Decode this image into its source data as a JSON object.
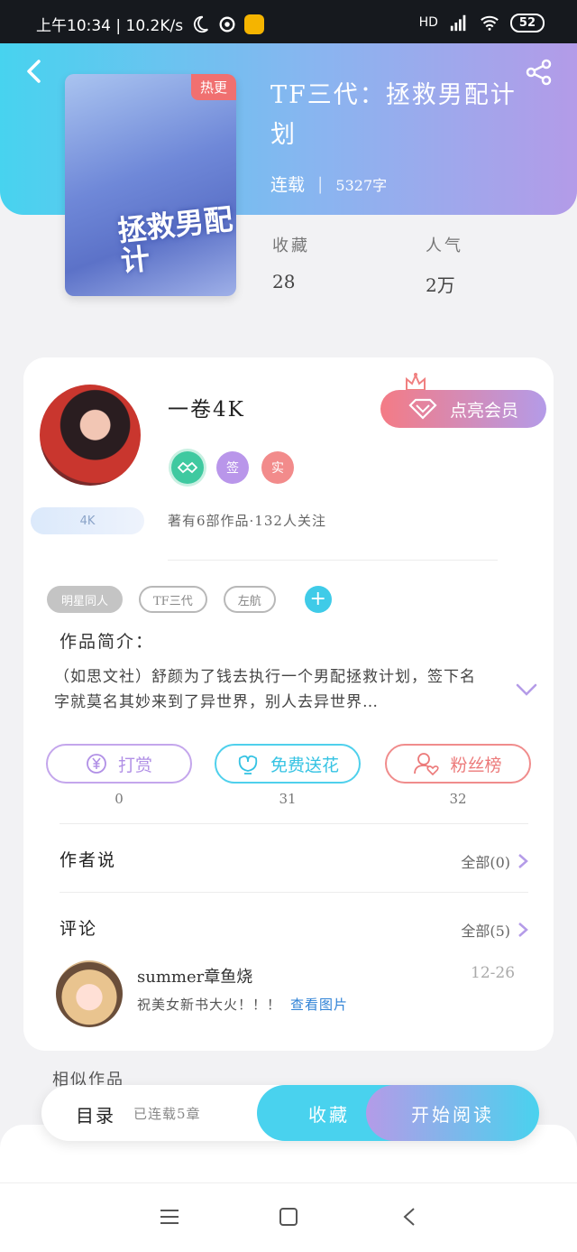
{
  "status_bar": {
    "time_speed": "上午10:34 | 10.2K/s",
    "network": "HD",
    "battery": "52"
  },
  "book": {
    "cover_badge": "热更",
    "cover_title": "拯救男配计",
    "title": "TF三代：拯救男配计划",
    "status": "连载",
    "separator": "|",
    "words": "5327字",
    "favorites_label": "收藏",
    "favorites_value": "28",
    "popularity_label": "人气",
    "popularity_value": "2万"
  },
  "author": {
    "name": "一卷4K",
    "badges": [
      "签",
      "实"
    ],
    "level_tag": "4K",
    "stats": "著有6部作品·132人关注",
    "vip_button": "点亮会员"
  },
  "tags": [
    "明星同人",
    "TF三代",
    "左航"
  ],
  "intro": {
    "label": "作品简介：",
    "text": "（如思文社）舒颜为了钱去执行一个男配拯救计划，签下名字就莫名其妙来到了异世界，别人去异世界…"
  },
  "actions": [
    {
      "label": "打赏",
      "count": "0"
    },
    {
      "label": "免费送花",
      "count": "31"
    },
    {
      "label": "粉丝榜",
      "count": "32"
    }
  ],
  "author_says": {
    "label": "作者说",
    "more": "全部(0)"
  },
  "comments": {
    "label": "评论",
    "more": "全部(5)",
    "items": [
      {
        "name": "summer章鱼烧",
        "date": "12-26",
        "text": "祝美女新书大火！！！",
        "link": "查看图片"
      }
    ]
  },
  "similar": {
    "label": "相似作品"
  },
  "bottom": {
    "toc": "目录",
    "chapters": "已连载5章",
    "collect": "收藏",
    "read": "开始阅读"
  },
  "colors": {
    "hero_start": "#47d3ef",
    "hero_end": "#b39be8",
    "accent_cyan": "#49d2ee",
    "accent_purple": "#b49be8",
    "accent_red": "#f07070"
  }
}
